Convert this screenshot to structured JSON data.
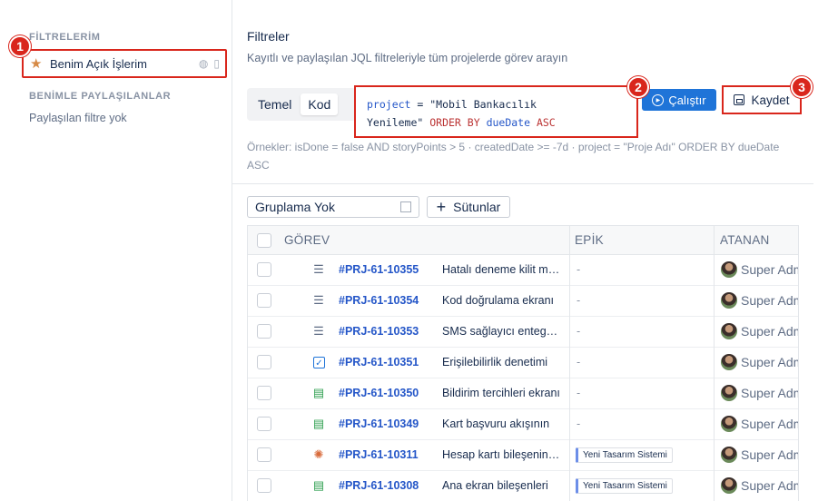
{
  "sidebar": {
    "my_filters_title": "FİLTRELERİM",
    "my_filter_item": "Benim Açık İşlerim",
    "shared_title": "BENİMLE PAYLAŞILANLAR",
    "shared_empty": "Paylaşılan filtre yok"
  },
  "annotations": [
    "1",
    "2",
    "3"
  ],
  "header": {
    "title": "Filtreler",
    "subtitle": "Kayıtlı ve paylaşılan JQL filtreleriyle tüm projelerde görev arayın"
  },
  "query": {
    "mode_basic": "Temel",
    "mode_code": "Kod",
    "jql_line1_key": "project",
    "jql_line1_op": " = ",
    "jql_line1_str": "\"Mobil Bankacılık",
    "jql_line2_str": "Yenileme\"",
    "jql_line2_order": " ORDER BY ",
    "jql_line2_field": "dueDate",
    "jql_line2_dir": " ASC",
    "run_label": "Çalıştır",
    "save_label": "Kaydet",
    "examples": "Örnekler: isDone = false AND storyPoints > 5 · createdDate >= -7d · project = \"Proje Adı\" ORDER BY dueDate ASC"
  },
  "toolbar": {
    "group_value": "Gruplama Yok",
    "columns_label": "Sütunlar"
  },
  "table": {
    "headers": {
      "task": "GÖREV",
      "epic": "EPİK",
      "assignee": "ATANAN"
    },
    "rows": [
      {
        "type": "list-icon",
        "key": "#PRJ-61-10355",
        "summary": "Hatalı deneme kilit mekanizması",
        "epic": "-",
        "assignee": "Super Admin"
      },
      {
        "type": "list-icon",
        "key": "#PRJ-61-10354",
        "summary": "Kod doğrulama ekranı",
        "epic": "-",
        "assignee": "Super Admin"
      },
      {
        "type": "list-icon",
        "key": "#PRJ-61-10353",
        "summary": "SMS sağlayıcı entegrasyonu",
        "epic": "-",
        "assignee": "Super Admin"
      },
      {
        "type": "checkbox-icon",
        "key": "#PRJ-61-10351",
        "summary": "Erişilebilirlik denetimi",
        "epic": "-",
        "assignee": "Super Admin"
      },
      {
        "type": "document-icon",
        "key": "#PRJ-61-10350",
        "summary": "Bildirim tercihleri ekranı",
        "epic": "-",
        "assignee": "Super Admin"
      },
      {
        "type": "document-icon",
        "key": "#PRJ-61-10349",
        "summary": "Kart başvuru akışının",
        "epic": "-",
        "assignee": "Super Admin"
      },
      {
        "type": "bug-icon",
        "key": "#PRJ-61-10311",
        "summary": "Hesap kartı bileşeninde",
        "epic": "Yeni Tasarım Sistemi",
        "assignee": "Super Admin"
      },
      {
        "type": "document-icon",
        "key": "#PRJ-61-10308",
        "summary": "Ana ekran bileşenleri",
        "epic": "Yeni Tasarım Sistemi",
        "assignee": "Super Admin"
      }
    ]
  }
}
